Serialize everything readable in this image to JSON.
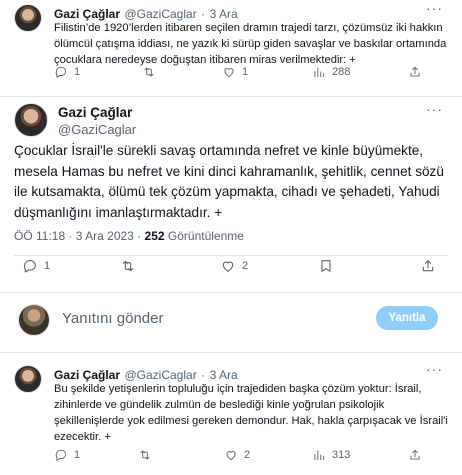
{
  "tweet1": {
    "name": "Gazi Çağlar",
    "handle": "@GaziCaglar",
    "dot": "·",
    "date": "3 Ara",
    "more": "···",
    "text": "Filistin’de 1920’lerden itibaren seçilen dramın trajedi tarzı, çözümsüz iki hakkın ölümcül çatışma iddiası, ne yazık ki sürüp giden savaşlar ve baskılar ortamında çocuklara neredeyse doğuştan itibaren miras verilmektedir: +",
    "replies": "1",
    "retweets": "",
    "likes": "1",
    "views": "288"
  },
  "main": {
    "name": "Gazi Çağlar",
    "handle": "@GaziCaglar",
    "more": "···",
    "text": "Çocuklar İsrail'le sürekli savaş ortamında nefret ve kinle büyümekte, mesela Hamas bu nefret ve kini dinci kahramanlık, şehitlik, cennet sözü ile kutsamakta, ölümü tek çözüm yapmakta, cihadı ve şehadeti, Yahudi düşmanlığını imanlaştırmaktadır. +",
    "time_date": "ÖÖ 11:18 · 3 Ara 2023 ·",
    "views_count": "252",
    "views_label": "Görüntülenme",
    "replies": "1",
    "retweets": "",
    "likes": "2",
    "bookmarks": ""
  },
  "reply": {
    "placeholder": "Yanıtını gönder",
    "button": "Yanıtla"
  },
  "tweet3": {
    "name": "Gazi Çağlar",
    "handle": "@GaziCaglar",
    "dot": "·",
    "date": "3 Ara",
    "more": "···",
    "text": "Bu şekilde yetişenlerin topluluğu için trajediden başka çözüm yoktur: İsrail, zihinlerde ve gündelik zulmün de beslediği kinle yoğrulan psikolojik şekillenişlerde yok edilmesi gereken demondur. Hak, hakla çarpışacak ve İsrail'i ezecektir. +",
    "replies": "1",
    "retweets": "",
    "likes": "2",
    "views": "313"
  },
  "colors": {
    "text": "#0f1419",
    "muted": "#536471",
    "accent": "#1d9bf0",
    "button_disabled": "#8ecdf7",
    "divider": "#dfe4e8"
  },
  "icons": [
    "reply-icon",
    "retweet-icon",
    "like-icon",
    "views-icon",
    "bookmark-icon",
    "share-icon",
    "more-icon"
  ]
}
